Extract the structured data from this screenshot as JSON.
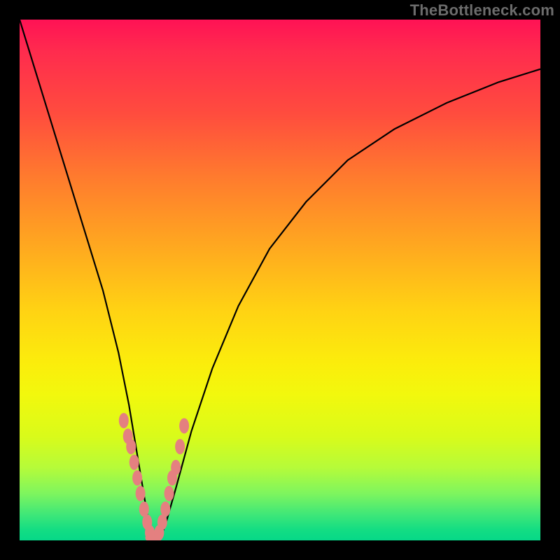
{
  "watermark": "TheBottleneck.com",
  "chart_data": {
    "type": "line",
    "title": "",
    "xlabel": "",
    "ylabel": "",
    "xlim": [
      0,
      100
    ],
    "ylim": [
      0,
      100
    ],
    "series": [
      {
        "name": "curve",
        "x": [
          0,
          4,
          8,
          12,
          16,
          19,
          21,
          22.5,
          24,
          25,
          26,
          27,
          28,
          30,
          33,
          37,
          42,
          48,
          55,
          63,
          72,
          82,
          92,
          100
        ],
        "values": [
          100,
          87,
          74,
          61,
          48,
          36,
          26,
          17,
          8,
          2,
          0,
          0.5,
          3,
          10,
          21,
          33,
          45,
          56,
          65,
          73,
          79,
          84,
          88,
          90.5
        ]
      },
      {
        "name": "highlighted-points-left",
        "x": [
          20,
          20.8,
          21.4,
          22,
          22.6,
          23.2,
          23.9,
          24.5,
          25
        ],
        "values": [
          23,
          20,
          18,
          15,
          12,
          9,
          6,
          3.5,
          1.5
        ]
      },
      {
        "name": "highlighted-points-right",
        "x": [
          26.8,
          27.4,
          28,
          28.7,
          29.3,
          30,
          30.8,
          31.6
        ],
        "values": [
          1.5,
          3.5,
          6,
          9,
          12,
          14,
          18,
          22
        ]
      },
      {
        "name": "highlighted-points-bottom",
        "x": [
          25.2,
          25.6,
          26.2
        ],
        "values": [
          0.5,
          0.3,
          0.4
        ]
      }
    ],
    "grid": false,
    "legend": false
  },
  "colors": {
    "curve_stroke": "#000000",
    "marker_fill": "#e48080",
    "background_top": "#ff1255",
    "background_bottom": "#06d888"
  }
}
